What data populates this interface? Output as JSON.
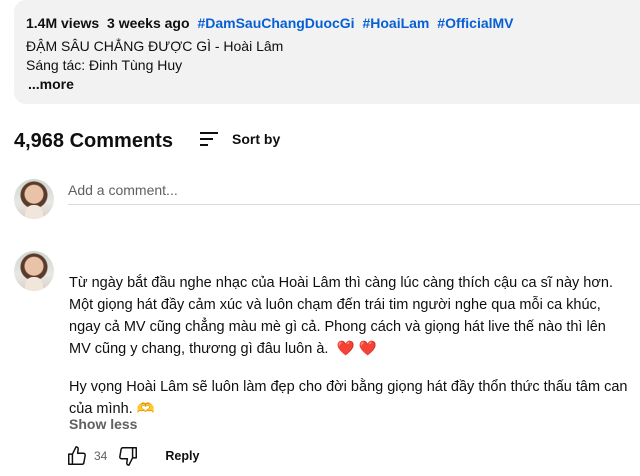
{
  "description": {
    "views": "1.4M views",
    "age": "3 weeks ago",
    "hashtags": [
      "#DamSauChangDuocGi",
      "#HoaiLam",
      "#OfficialMV"
    ],
    "title_line": "ĐẬM SÂU CHẲNG ĐƯỢC GÌ - Hoài Lâm",
    "composer_line": "Sáng tác: Đinh Tùng Huy",
    "more_label": "...more"
  },
  "comments": {
    "count_label": "4,968 Comments",
    "sort_label": "Sort by",
    "add_placeholder": "Add a comment..."
  },
  "comment": {
    "paragraph1": "Từ ngày bắt đầu nghe nhạc của Hoài Lâm thì càng lúc càng thích cậu ca sĩ này hơn.  Một giọng hát đầy cảm xúc và luôn chạm đến trái tim người nghe qua mỗi ca khúc, ngay cả MV cũng chẳng màu mè gì cả.  Phong cách và giọng hát live thế nào thì lên MV cũng y chang, thương gì đâu luôn à.",
    "paragraph1_hearts": "❤️ ❤️",
    "paragraph2": "Hy vọng Hoài Lâm sẽ luôn làm đẹp cho đời bằng giọng hát đầy thổn thức thấu tâm can của mình.",
    "paragraph2_emoji": "🫶",
    "show_less": "Show less",
    "likes": "34",
    "reply_label": "Reply"
  },
  "icons": {
    "sort": "sort-icon",
    "like": "thumbs-up-icon",
    "dislike": "thumbs-down-icon"
  },
  "colors": {
    "hashtag": "#065fd4",
    "heart": "#e02424",
    "desc_bg": "#f2f2f2"
  }
}
